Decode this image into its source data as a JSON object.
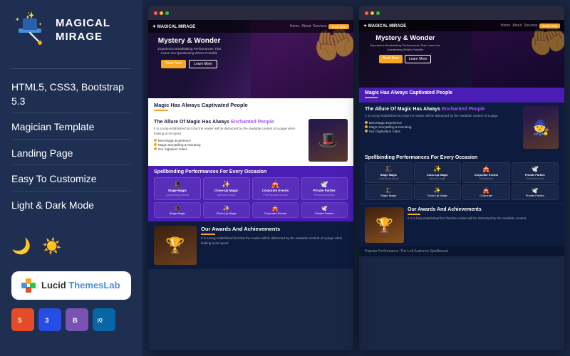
{
  "left_panel": {
    "logo": {
      "text_line1": "MAGICAL",
      "text_line2": "MIRAGE"
    },
    "features": [
      {
        "id": "f1",
        "label": "HTML5, CSS3, Bootstrap 5.3"
      },
      {
        "id": "f2",
        "label": "Magician Template"
      },
      {
        "id": "f3",
        "label": "Landing Page"
      },
      {
        "id": "f4",
        "label": "Easy To Customize"
      },
      {
        "id": "f5",
        "label": "Light & Dark Mode"
      }
    ],
    "brand_badge": {
      "icon_label": "puzzle-icon",
      "text_prefix": "Lucid ",
      "text_highlight": "ThemesLab"
    },
    "tech_badges": [
      {
        "id": "html5",
        "label": "5",
        "title": "HTML5",
        "class": "html5"
      },
      {
        "id": "css3",
        "label": "3",
        "title": "CSS3",
        "class": "css3"
      },
      {
        "id": "bootstrap",
        "label": "B",
        "title": "Bootstrap",
        "class": "bootstrap"
      },
      {
        "id": "jquery",
        "label": "jQ",
        "title": "jQuery",
        "class": "jquery"
      }
    ]
  },
  "preview": {
    "hero": {
      "title": "Mystery & Wonder",
      "subtitle": "Experience Breathtaking Performances That Leave You Questioning What's Possible",
      "cta_primary": "Book Now",
      "cta_secondary": "Learn More"
    },
    "section1": {
      "title": "Magic Has Always Captivated People",
      "subtitle": "The Allure Of Magic Has Always Enchanted People"
    },
    "section2": {
      "title": "Spellbinding Performances For Every Occasion"
    },
    "section3": {
      "title": "Our Awards And Achievements"
    },
    "services": [
      {
        "icon": "🎩",
        "name": "Stage Magic",
        "desc": "Captivating shows"
      },
      {
        "icon": "✨",
        "name": "Close-Up Magic",
        "desc": "Intimate magic"
      },
      {
        "icon": "🎪",
        "name": "Corporate Events",
        "desc": "Professional shows"
      },
      {
        "icon": "🕊️",
        "name": "Private Parties",
        "desc": "Personal events"
      }
    ],
    "bullets": [
      "Best Magic Experience",
      "Magic Storytelling & Narrating",
      "Our Signature Glass"
    ]
  },
  "colors": {
    "accent": "#f5a623",
    "purple": "#7c3aed",
    "navy": "#0d1b3e",
    "dark_bg": "#1a2744"
  }
}
